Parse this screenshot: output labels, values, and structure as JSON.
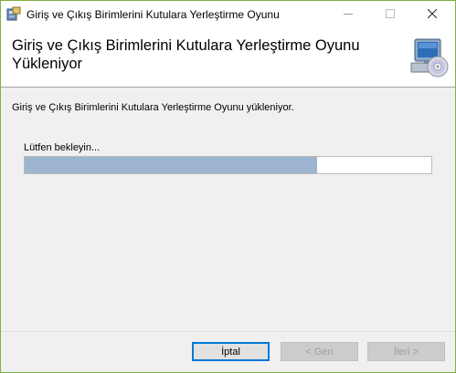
{
  "window": {
    "title": "Giriş ve Çıkış Birimlerini Kutulara Yerleştirme Oyunu",
    "border_color": "#7fb142"
  },
  "titlebar": {
    "icons": [
      "installer-app-icon",
      "minimize-icon",
      "maximize-icon",
      "close-icon"
    ]
  },
  "header": {
    "title": "Giriş ve Çıkış Birimlerini Kutulara Yerleştirme Oyunu Yükleniyor",
    "icon": "computer-cd-icon"
  },
  "main": {
    "description": "Giriş ve Çıkış Birimlerini Kutulara Yerleştirme Oyunu yükleniyor.",
    "wait_label": "Lütfen bekleyin...",
    "progress_fraction": 0.72,
    "progress_color": "#9db5d0"
  },
  "buttons": {
    "cancel": "İptal",
    "back": "< Geri",
    "next": "İleri >"
  }
}
